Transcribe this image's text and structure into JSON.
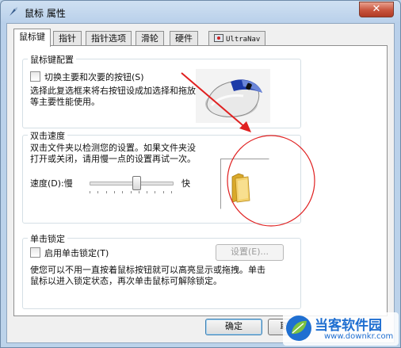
{
  "window": {
    "title": "鼠标 属性",
    "close_label": "✕",
    "title_icon": "mouse-pointer-icon"
  },
  "tabs": [
    {
      "label": "鼠标键",
      "active": true
    },
    {
      "label": "指针",
      "active": false
    },
    {
      "label": "指针选项",
      "active": false
    },
    {
      "label": "滑轮",
      "active": false
    },
    {
      "label": "硬件",
      "active": false
    },
    {
      "label": "UltraNav",
      "active": false,
      "icon": "trackpoint-icon"
    }
  ],
  "button_config": {
    "legend": "鼠标键配置",
    "switch_checkbox": {
      "label": "切换主要和次要的按钮(S)",
      "checked": false
    },
    "description": [
      "选择此复选框来将右按钮设成加选择和拖放",
      "等主要性能使用。"
    ],
    "image_icon": "mouse-icon"
  },
  "double_click": {
    "legend": "双击速度",
    "description": [
      "双击文件夹以检测您的设置。如果文件夹没",
      "打开或关闭，请用慢一点的设置再试一次。"
    ],
    "speed_label": "速度(D):慢",
    "fast_label": "快",
    "speed_fraction": 0.57,
    "folder_icon": "folder-icon"
  },
  "click_lock": {
    "legend": "单击锁定",
    "checkbox": {
      "label": "启用单击锁定(T)",
      "checked": false
    },
    "settings_button": "设置(E)...",
    "description": [
      "使您可以不用一直按着鼠标按钮就可以高亮显示或拖拽。单击",
      "鼠标以进入锁定状态，再次单击鼠标可解除锁定。"
    ]
  },
  "footer": {
    "ok_label": "确定",
    "cancel_label": "取"
  },
  "watermark": {
    "brand": "当客软件园",
    "url": "www.downkr.com",
    "logo_icon": "leaf-logo-icon"
  },
  "colors": {
    "annotation_red": "#e02020",
    "window_frame": "#bcd3ea",
    "watermark_blue": "#1f6fd1"
  }
}
